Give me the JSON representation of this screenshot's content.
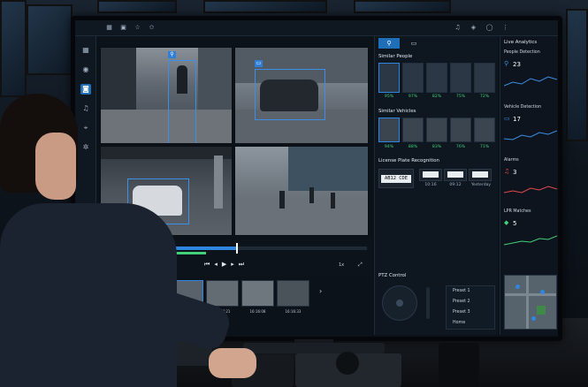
{
  "topbar": {
    "left_icons": [
      "grid-icon",
      "calendar-icon",
      "star-outline-icon",
      "star-icon"
    ],
    "right_icons": [
      "bell-icon",
      "shield-icon",
      "user-icon",
      "more-icon"
    ]
  },
  "sidebar": {
    "items": [
      {
        "icon": "grid-icon",
        "active": false
      },
      {
        "icon": "alert-icon",
        "active": false
      },
      {
        "icon": "camera-icon",
        "active": true
      },
      {
        "icon": "bell-icon",
        "active": false
      },
      {
        "icon": "location-icon",
        "active": false
      },
      {
        "icon": "settings-icon",
        "active": false
      }
    ]
  },
  "playback": {
    "speed": "1x",
    "controls": [
      "skip-back-icon",
      "step-back-icon",
      "play-icon",
      "step-forward-icon",
      "skip-forward-icon"
    ]
  },
  "clips": [
    {
      "time": "16:16:08"
    },
    {
      "time": "16:16:00"
    },
    {
      "time": "16:16:45"
    },
    {
      "time": "17:17:21"
    },
    {
      "time": "16:16:08"
    },
    {
      "time": "16:16:33"
    }
  ],
  "similar_people": {
    "title": "Similar People",
    "matches": [
      "95%",
      "97%",
      "82%",
      "75%",
      "72%"
    ]
  },
  "similar_vehicles": {
    "title": "Similar Vehicles",
    "matches": [
      "94%",
      "88%",
      "83%",
      "76%",
      "71%"
    ]
  },
  "plate_recognition": {
    "title": "License Plate Recognition",
    "current_plate": "AB12 CDE",
    "history": [
      {
        "time": "10:16"
      },
      {
        "time": "09:12"
      },
      {
        "time": "Yesterday"
      }
    ]
  },
  "ptz": {
    "title": "PTZ Control",
    "presets": [
      "Preset 1",
      "Preset 2",
      "Preset 3",
      "Home"
    ]
  },
  "live_analytics": {
    "title": "Live Analytics",
    "metrics": [
      {
        "label": "People Detection",
        "value": "23",
        "color": "#3b8fe8",
        "icon": "person-icon"
      },
      {
        "label": "Vehicle Detection",
        "value": "17",
        "color": "#3b8fe8",
        "icon": "car-icon"
      },
      {
        "label": "Alarms",
        "value": "3",
        "color": "#e5484d",
        "icon": "bell-icon"
      },
      {
        "label": "LPR Matches",
        "value": "5",
        "color": "#42d17a",
        "icon": "tag-icon"
      }
    ]
  },
  "colors": {
    "accent": "#1f6fb8",
    "box": "#3b8fe8",
    "match_green": "#42d17a"
  }
}
